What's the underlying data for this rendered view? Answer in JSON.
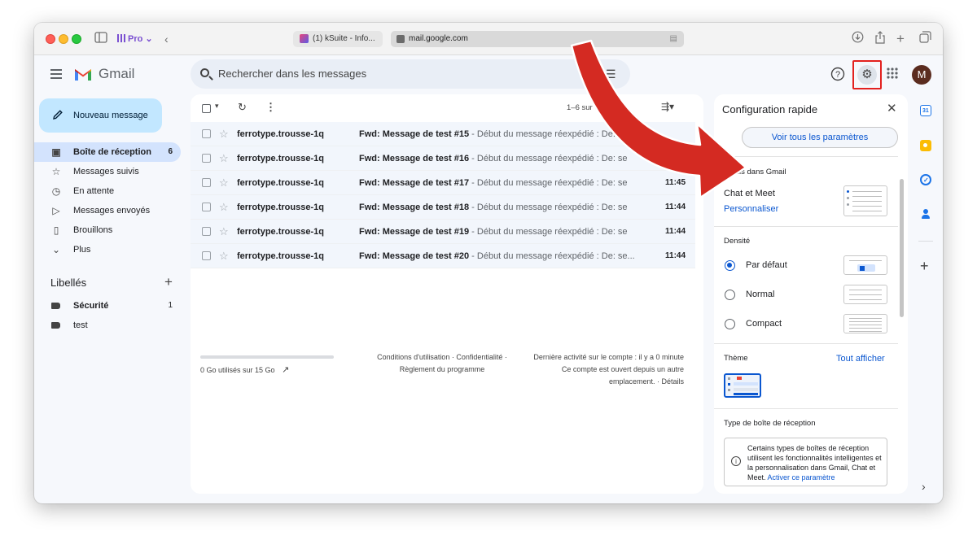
{
  "browser": {
    "profile_label": "Pro",
    "tab_title": "(1) kSuite - Info...",
    "url": "mail.google.com"
  },
  "gmail": {
    "logo_text": "Gmail",
    "search_placeholder": "Rechercher dans les messages",
    "avatar_letter": "M"
  },
  "sidebar": {
    "compose_label": "Nouveau message",
    "items": [
      {
        "label": "Boîte de réception",
        "count": "6",
        "icon": "inbox-icon"
      },
      {
        "label": "Messages suivis",
        "icon": "star-icon"
      },
      {
        "label": "En attente",
        "icon": "clock-icon"
      },
      {
        "label": "Messages envoyés",
        "icon": "send-icon"
      },
      {
        "label": "Brouillons",
        "icon": "draft-icon"
      },
      {
        "label": "Plus",
        "icon": "chevron-down-icon"
      }
    ],
    "labels_title": "Libellés",
    "labels": [
      {
        "name": "Sécurité",
        "count": "1"
      },
      {
        "name": "test"
      }
    ]
  },
  "toolbar": {
    "pagination": "1–6 sur 6"
  },
  "emails": [
    {
      "sender": "ferrotype.trousse-1q",
      "subject": "Fwd: Message de test #15",
      "snippet": " - Début du message réexpédié : De: se...",
      "time": ""
    },
    {
      "sender": "ferrotype.trousse-1q",
      "subject": "Fwd: Message de test #16",
      "snippet": " - Début du message réexpédié : De: se...",
      "time": "11:45"
    },
    {
      "sender": "ferrotype.trousse-1q",
      "subject": "Fwd: Message de test #17",
      "snippet": " - Début du message réexpédié : De: se...",
      "time": "11:45"
    },
    {
      "sender": "ferrotype.trousse-1q",
      "subject": "Fwd: Message de test #18",
      "snippet": " - Début du message réexpédié : De: se...",
      "time": "11:44"
    },
    {
      "sender": "ferrotype.trousse-1q",
      "subject": "Fwd: Message de test #19",
      "snippet": " - Début du message réexpédié : De: se...",
      "time": "11:44"
    },
    {
      "sender": "ferrotype.trousse-1q",
      "subject": "Fwd: Message de test #20",
      "snippet": " - Début du message réexpédié : De: se...",
      "time": "11:44"
    }
  ],
  "footer": {
    "storage": "0 Go utilisés sur 15 Go",
    "terms_line1": "Conditions d'utilisation · Confidentialité ·",
    "terms_line2": "Règlement du programme",
    "activity_line1": "Dernière activité sur le compte : il y a 0 minute",
    "activity_line2": "Ce compte est ouvert depuis un autre",
    "activity_line3": "emplacement. · Détails"
  },
  "quick_settings": {
    "title": "Configuration rapide",
    "see_all": "Voir tous les paramètres",
    "apps_section": "Applis dans Gmail",
    "chat_meet": "Chat et Meet",
    "customize": "Personnaliser",
    "density_section": "Densité",
    "density_options": [
      "Par défaut",
      "Normal",
      "Compact"
    ],
    "theme_section": "Thème",
    "theme_show_all": "Tout afficher",
    "inbox_type_section": "Type de boîte de réception",
    "inbox_type_info": "Certains types de boîtes de réception utilisent les fonctionnalités intelligentes et la personnalisation dans Gmail, Chat et Meet.",
    "inbox_type_link": "Activer ce paramètre"
  },
  "colors": {
    "accent": "#0b57d0",
    "compose_bg": "#c2e7ff",
    "active_nav": "#d3e3fd",
    "highlight_box": "#e3211f",
    "arrow": "#d42a22"
  }
}
